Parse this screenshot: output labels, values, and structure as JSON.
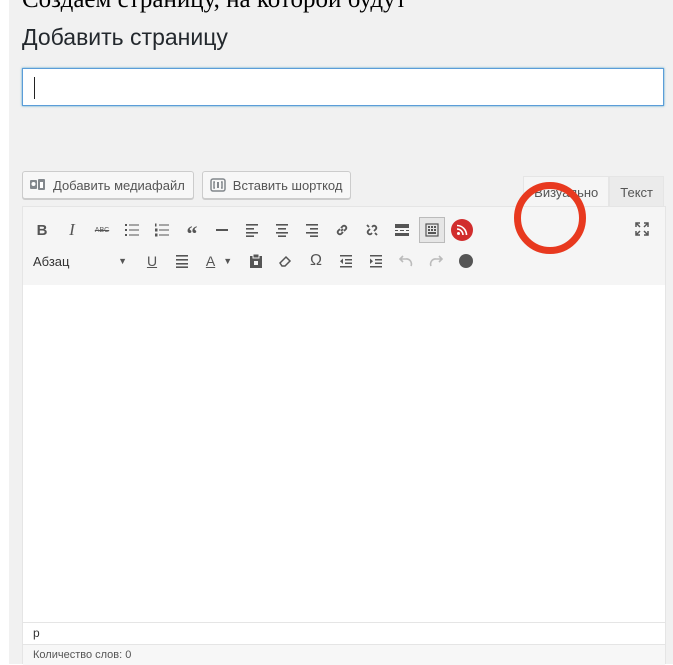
{
  "caption": "Создаем страницу, на которой будут",
  "page": {
    "title": "Добавить страницу",
    "title_input_value": ""
  },
  "media_buttons": {
    "add_media": "Добавить медиафайл",
    "insert_shortcode": "Вставить шорткод"
  },
  "tabs": {
    "visual": "Визуально",
    "text": "Текст",
    "active": "visual"
  },
  "toolbar": {
    "row1": [
      "bold",
      "italic",
      "strikethrough",
      "bullet-list",
      "numbered-list",
      "blockquote",
      "horizontal-rule",
      "align-left",
      "align-center",
      "align-right",
      "insert-link",
      "remove-link",
      "read-more",
      "toolbar-toggle",
      "rss"
    ],
    "row2_format": "Абзац",
    "row2": [
      "underline",
      "justify",
      "text-color",
      "paste-as-text",
      "clear-formatting",
      "special-character",
      "outdent",
      "indent",
      "undo",
      "redo",
      "help"
    ]
  },
  "labels": {
    "bold": "B",
    "italic": "I",
    "strike": "ABC",
    "underline": "U",
    "color": "A",
    "omega": "Ω",
    "blockquote": "“"
  },
  "path": "p",
  "word_count": "Количество слов: 0",
  "colors": {
    "highlight": "#e8391f",
    "rss": "#d12d2d",
    "focus": "#5b9dd9"
  }
}
